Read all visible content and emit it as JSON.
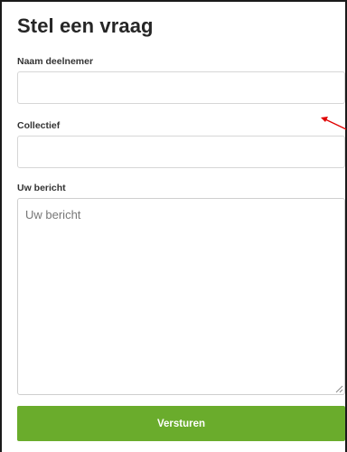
{
  "form": {
    "title": "Stel een vraag",
    "fields": {
      "name": {
        "label": "Naam deelnemer",
        "value": ""
      },
      "collectief": {
        "label": "Collectief",
        "value": ""
      },
      "message": {
        "label": "Uw bericht",
        "placeholder": "Uw bericht"
      }
    },
    "submit_label": "Versturen"
  },
  "colors": {
    "accent_green": "#6aac2c",
    "annotation_arrow": "#e00000"
  },
  "icons": {
    "annotation": "arrow-icon",
    "resize": "resize-grip-icon"
  }
}
